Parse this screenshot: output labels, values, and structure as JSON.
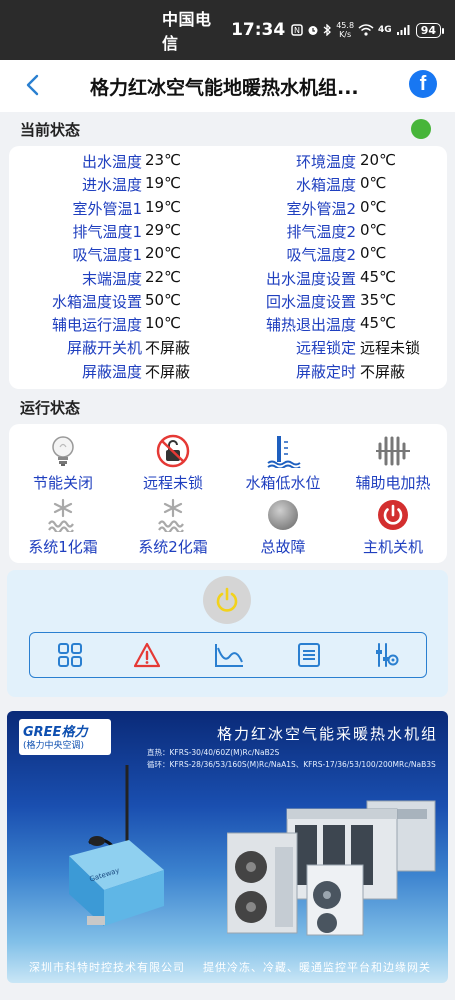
{
  "statusbar": {
    "carrier": "中国电信",
    "time": "17:34",
    "net_speed_value": "45.8",
    "net_speed_unit": "K/s",
    "signal_label": "4G",
    "battery": "94"
  },
  "header": {
    "title": "格力红冰空气能地暖热水机组...",
    "share_label": "f"
  },
  "current_status": {
    "title": "当前状态",
    "online_color": "#47b53a",
    "rows": [
      {
        "l1": "出水温度",
        "v1": "23℃",
        "l2": "环境温度",
        "v2": "20℃"
      },
      {
        "l1": "进水温度",
        "v1": "19℃",
        "l2": "水箱温度",
        "v2": "0℃"
      },
      {
        "l1": "室外管温1",
        "v1": "19℃",
        "l2": "室外管温2",
        "v2": "0℃"
      },
      {
        "l1": "排气温度1",
        "v1": "29℃",
        "l2": "排气温度2",
        "v2": "0℃"
      },
      {
        "l1": "吸气温度1",
        "v1": "20℃",
        "l2": "吸气温度2",
        "v2": "0℃"
      },
      {
        "l1": "末端温度",
        "v1": "22℃",
        "l2": "出水温度设置",
        "v2": "45℃"
      },
      {
        "l1": "水箱温度设置",
        "v1": "50℃",
        "l2": "回水温度设置",
        "v2": "35℃"
      },
      {
        "l1": "辅电运行温度",
        "v1": "10℃",
        "l2": "辅热退出温度",
        "v2": "45℃"
      },
      {
        "l1": "屏蔽开关机",
        "v1": "不屏蔽",
        "l2": "远程锁定",
        "v2": "远程未锁"
      },
      {
        "l1": "屏蔽温度",
        "v1": "不屏蔽",
        "l2": "屏蔽定时",
        "v2": "不屏蔽"
      }
    ]
  },
  "run_status": {
    "title": "运行状态",
    "items": [
      {
        "label": "节能关闭",
        "icon": "bulb-icon"
      },
      {
        "label": "远程未锁",
        "icon": "unlock-icon"
      },
      {
        "label": "水箱低水位",
        "icon": "water-level-icon"
      },
      {
        "label": "辅助电加热",
        "icon": "heater-icon"
      },
      {
        "label": "系统1化霜",
        "icon": "defrost-icon"
      },
      {
        "label": "系统2化霜",
        "icon": "defrost-icon"
      },
      {
        "label": "总故障",
        "icon": "fault-icon"
      },
      {
        "label": "主机关机",
        "icon": "power-off-icon"
      }
    ]
  },
  "control": {
    "power_color": "#f2d21c",
    "accent": "#2a7fd0",
    "toolbar": [
      "grid-icon",
      "warning-icon",
      "curve-chart-icon",
      "list-icon",
      "settings-sliders-icon"
    ]
  },
  "banner": {
    "brand": "GREE格力",
    "brand_sub": "(格力中央空调)",
    "title": "格力红冰空气能采暖热水机组",
    "line1": "直热：KFRS-30/40/60Z(M)Rc/NaB2S",
    "line2": "循环：KFRS-28/36/53/160S(M)Rc/NaA1S、KFRS-17/36/53/100/200MRc/NaB3S",
    "gateway_label": "Gateway",
    "footer_company": "深圳市科特时控技术有限公司",
    "footer_slogan": "提供冷冻、冷藏、暖通监控平台和边缘网关"
  }
}
